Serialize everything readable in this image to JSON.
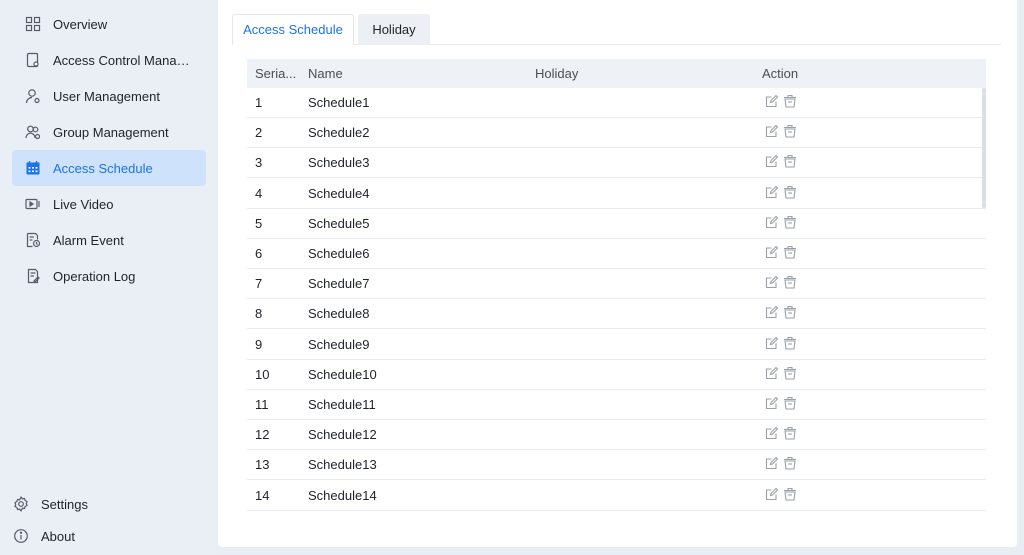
{
  "sidebar": {
    "items": [
      {
        "label": "Overview",
        "icon": "grid-icon"
      },
      {
        "label": "Access Control Manag...",
        "icon": "device-icon"
      },
      {
        "label": "User Management",
        "icon": "user-icon"
      },
      {
        "label": "Group Management",
        "icon": "group-icon"
      },
      {
        "label": "Access Schedule",
        "icon": "calendar-icon",
        "active": true
      },
      {
        "label": "Live Video",
        "icon": "video-icon"
      },
      {
        "label": "Alarm Event",
        "icon": "alarm-icon"
      },
      {
        "label": "Operation Log",
        "icon": "log-icon"
      }
    ],
    "bottom": [
      {
        "label": "Settings",
        "icon": "gear-icon"
      },
      {
        "label": "About",
        "icon": "info-icon"
      }
    ]
  },
  "tabs": [
    {
      "label": "Access Schedule",
      "active": true
    },
    {
      "label": "Holiday",
      "active": false
    }
  ],
  "table": {
    "columns": [
      "Seria...",
      "Name",
      "Holiday",
      "Action"
    ],
    "rows": [
      {
        "serial": "1",
        "name": "Schedule1",
        "holiday": ""
      },
      {
        "serial": "2",
        "name": "Schedule2",
        "holiday": ""
      },
      {
        "serial": "3",
        "name": "Schedule3",
        "holiday": ""
      },
      {
        "serial": "4",
        "name": "Schedule4",
        "holiday": ""
      },
      {
        "serial": "5",
        "name": "Schedule5",
        "holiday": ""
      },
      {
        "serial": "6",
        "name": "Schedule6",
        "holiday": ""
      },
      {
        "serial": "7",
        "name": "Schedule7",
        "holiday": ""
      },
      {
        "serial": "8",
        "name": "Schedule8",
        "holiday": ""
      },
      {
        "serial": "9",
        "name": "Schedule9",
        "holiday": ""
      },
      {
        "serial": "10",
        "name": "Schedule10",
        "holiday": ""
      },
      {
        "serial": "11",
        "name": "Schedule11",
        "holiday": ""
      },
      {
        "serial": "12",
        "name": "Schedule12",
        "holiday": ""
      },
      {
        "serial": "13",
        "name": "Schedule13",
        "holiday": ""
      },
      {
        "serial": "14",
        "name": "Schedule14",
        "holiday": ""
      }
    ],
    "action_icons": [
      "edit-icon",
      "delete-icon"
    ]
  },
  "colors": {
    "accent": "#1b73e8",
    "active_bg": "#cfe2fb",
    "sidebar_bg": "#eaeff5",
    "icon_gray": "#9aa0a8"
  }
}
